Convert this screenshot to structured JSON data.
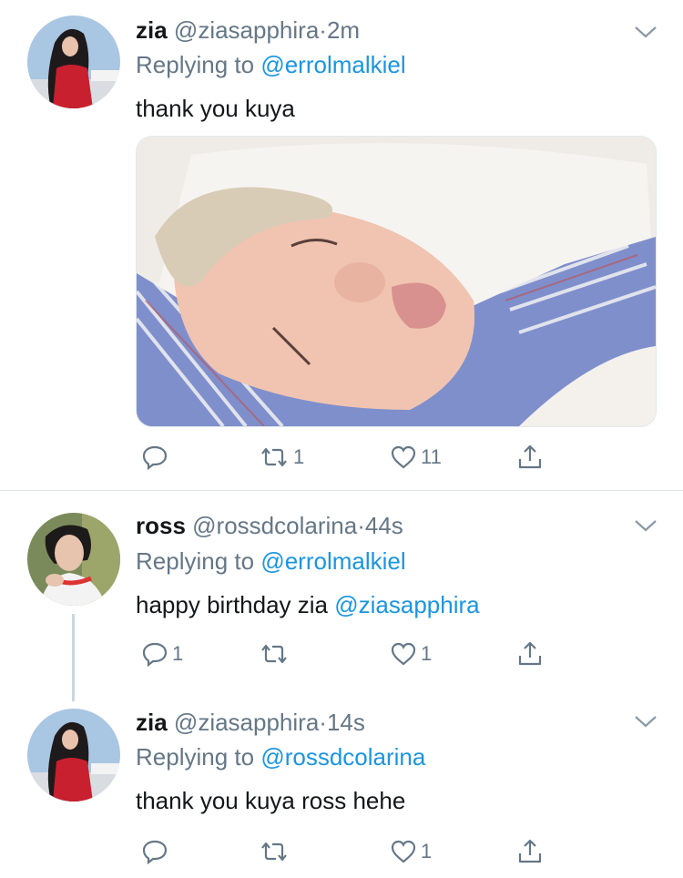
{
  "tweets": [
    {
      "name": "zia",
      "handle": "@ziasapphira",
      "dot": "·",
      "time": "2m",
      "replying_prefix": "Replying to ",
      "replying_to": "@errolmalkiel",
      "text": "thank you kuya",
      "text_mention": "",
      "reply_count": "",
      "retweet_count": "1",
      "like_count": "11"
    },
    {
      "name": "ross",
      "handle": "@rossdcolarina",
      "dot": "·",
      "time": "44s",
      "replying_prefix": "Replying to ",
      "replying_to": "@errolmalkiel",
      "text": "happy birthday zia ",
      "text_mention": "@ziasapphira",
      "reply_count": "1",
      "retweet_count": "",
      "like_count": "1"
    },
    {
      "name": "zia",
      "handle": "@ziasapphira",
      "dot": "·",
      "time": "14s",
      "replying_prefix": "Replying to ",
      "replying_to": "@rossdcolarina",
      "text": "thank you kuya ross hehe",
      "text_mention": "",
      "reply_count": "",
      "retweet_count": "",
      "like_count": "1"
    }
  ],
  "icons": {
    "reply": "reply-icon",
    "retweet": "retweet-icon",
    "like": "heart-icon",
    "share": "share-icon",
    "more": "chevron-down-icon"
  },
  "colors": {
    "text": "#14171a",
    "secondary": "#657786",
    "link": "#1b95e0",
    "divider": "#e1e8ed"
  }
}
